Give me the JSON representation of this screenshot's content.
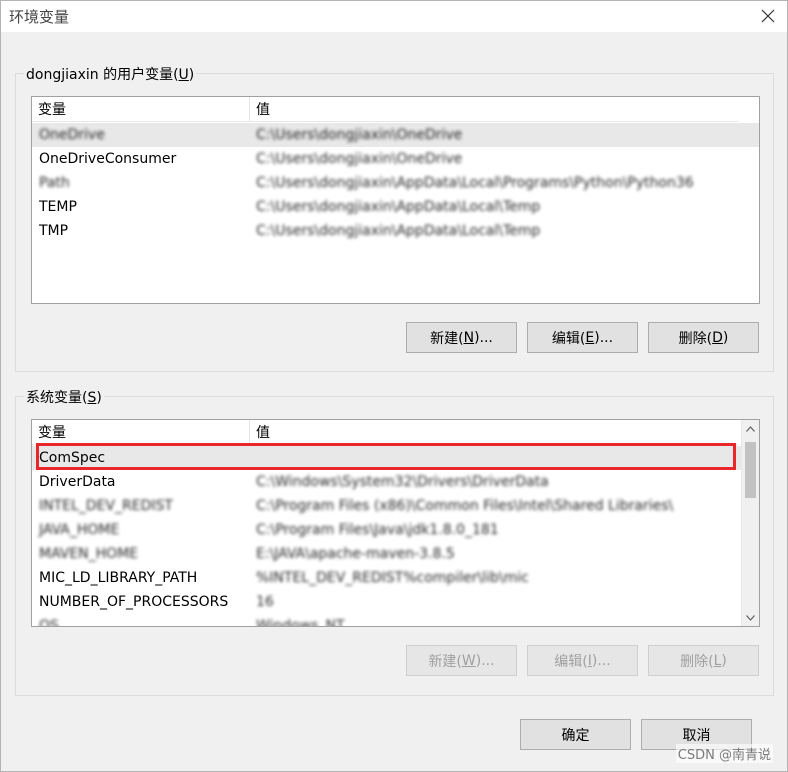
{
  "window": {
    "title": "环境变量"
  },
  "user_vars": {
    "label_prefix": "dongjiaxin 的用户变量(",
    "label_key": "U",
    "label_suffix": ")",
    "headers": [
      "变量",
      "值"
    ],
    "rows": [
      {
        "name": "OneDrive",
        "value": "C:\\Users\\dongjiaxin\\OneDrive"
      },
      {
        "name": "OneDriveConsumer",
        "value": "C:\\Users\\dongjiaxin\\OneDrive"
      },
      {
        "name": "Path",
        "value": "C:\\Users\\dongjiaxin\\AppData\\Local\\Programs\\Python\\Python36"
      },
      {
        "name": "TEMP",
        "value": "C:\\Users\\dongjiaxin\\AppData\\Local\\Temp"
      },
      {
        "name": "TMP",
        "value": "C:\\Users\\dongjiaxin\\AppData\\Local\\Temp"
      }
    ],
    "buttons": {
      "new_prefix": "新建(",
      "new_key": "N",
      "new_suffix": ")...",
      "edit_prefix": "编辑(",
      "edit_key": "E",
      "edit_suffix": ")...",
      "delete_prefix": "删除(",
      "delete_key": "D",
      "delete_suffix": ")"
    }
  },
  "system_vars": {
    "label_prefix": "系统变量(",
    "label_key": "S",
    "label_suffix": ")",
    "headers": [
      "变量",
      "值"
    ],
    "rows": [
      {
        "name": "ComSpec",
        "value": ""
      },
      {
        "name": "DriverData",
        "value": "C:\\Windows\\System32\\Drivers\\DriverData"
      },
      {
        "name": "INTEL_DEV_REDIST",
        "value": "C:\\Program Files (x86)\\Common Files\\Intel\\Shared Libraries\\"
      },
      {
        "name": "JAVA_HOME",
        "value": "C:\\Program Files\\Java\\jdk1.8.0_181"
      },
      {
        "name": "MAVEN_HOME",
        "value": "E:\\JAVA\\apache-maven-3.8.5"
      },
      {
        "name": "MIC_LD_LIBRARY_PATH",
        "value": "%INTEL_DEV_REDIST%compiler\\lib\\mic"
      },
      {
        "name": "NUMBER_OF_PROCESSORS",
        "value": "16"
      },
      {
        "name": "OS",
        "value": "Windows_NT"
      }
    ],
    "buttons": {
      "new_prefix": "新建(",
      "new_key": "W",
      "new_suffix": ")...",
      "edit_prefix": "编辑(",
      "edit_key": "I",
      "edit_suffix": ")...",
      "delete_prefix": "删除(",
      "delete_key": "L",
      "delete_suffix": ")"
    }
  },
  "footer": {
    "ok": "确定",
    "cancel": "取消"
  },
  "watermark": "CSDN @南青说",
  "colors": {
    "highlight_box": "#e8262c",
    "dialog_bg": "#f0f0f0"
  }
}
